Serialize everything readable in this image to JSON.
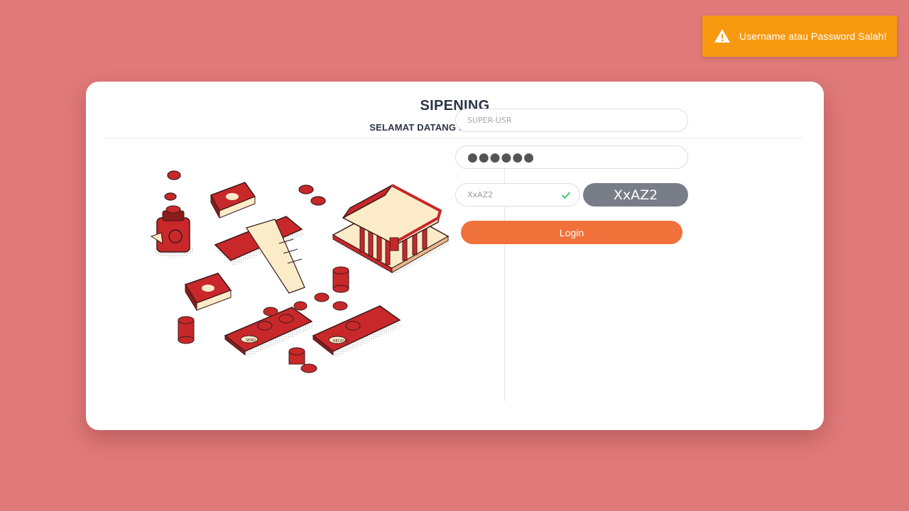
{
  "toast": {
    "message": "Username atau Password Salah!",
    "icon": "warning-icon"
  },
  "card": {
    "title": "SIPENING",
    "subtitle": "SELAMAT DATANG SILAHKAN LOGIN"
  },
  "form": {
    "username_placeholder": "SUPER-USR",
    "password_value": "●●●●●●",
    "captcha_value": "XxAZ2",
    "captcha_code": "XxAZ2",
    "login_label": "Login"
  },
  "illustration": {
    "send_label": "SEND",
    "receive_label": "RECEIVE"
  },
  "colors": {
    "background": "#df7a79",
    "toast": "#f7990f",
    "primary_button": "#f07139",
    "captcha_box": "#787d88",
    "illustration_red": "#c8282a",
    "illustration_cream": "#fcebc9"
  }
}
